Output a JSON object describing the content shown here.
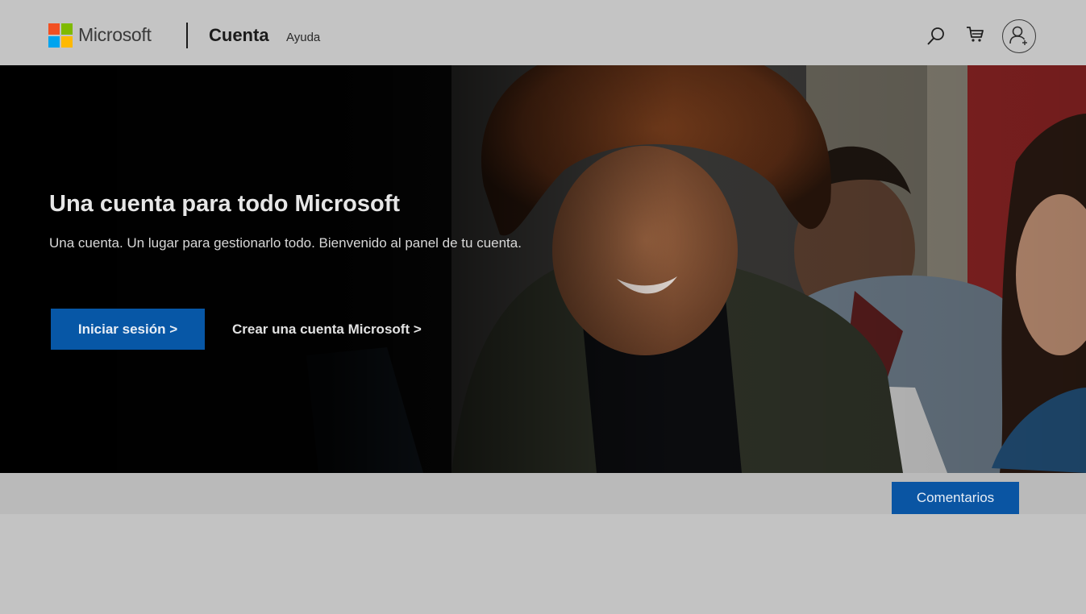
{
  "header": {
    "brand": "Microsoft",
    "section_title": "Cuenta",
    "help_link": "Ayuda",
    "logo_colors": [
      "#f25022",
      "#7fba00",
      "#00a4ef",
      "#ffb900"
    ],
    "icons": [
      "search-icon",
      "cart-icon",
      "account-icon"
    ]
  },
  "hero": {
    "title": "Una cuenta para todo Microsoft",
    "subtitle": "Una cuenta. Un lugar para gestionarlo todo. Bienvenido al panel de tu cuenta.",
    "signin_label": "Iniciar sesión >",
    "create_link": "Crear una cuenta Microsoft >",
    "accent_color": "#0757a6"
  },
  "footer": {
    "feedback_label": "Comentarios"
  }
}
